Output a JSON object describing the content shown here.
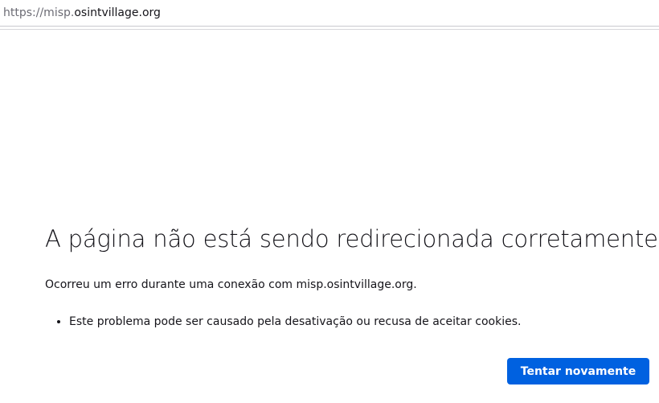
{
  "urlbar": {
    "scheme": "https://misp.",
    "domain": "osintvillage.org"
  },
  "error": {
    "title": "A página não está sendo redirecionada corretamente",
    "description": "Ocorreu um erro durante uma conexão com misp.osintvillage.org.",
    "hints": [
      "Este problema pode ser causado pela desativação ou recusa de aceitar cookies."
    ],
    "retry_label": "Tentar novamente"
  },
  "colors": {
    "accent": "#0061e0",
    "text": "#15141a",
    "muted": "#6b6b74"
  }
}
